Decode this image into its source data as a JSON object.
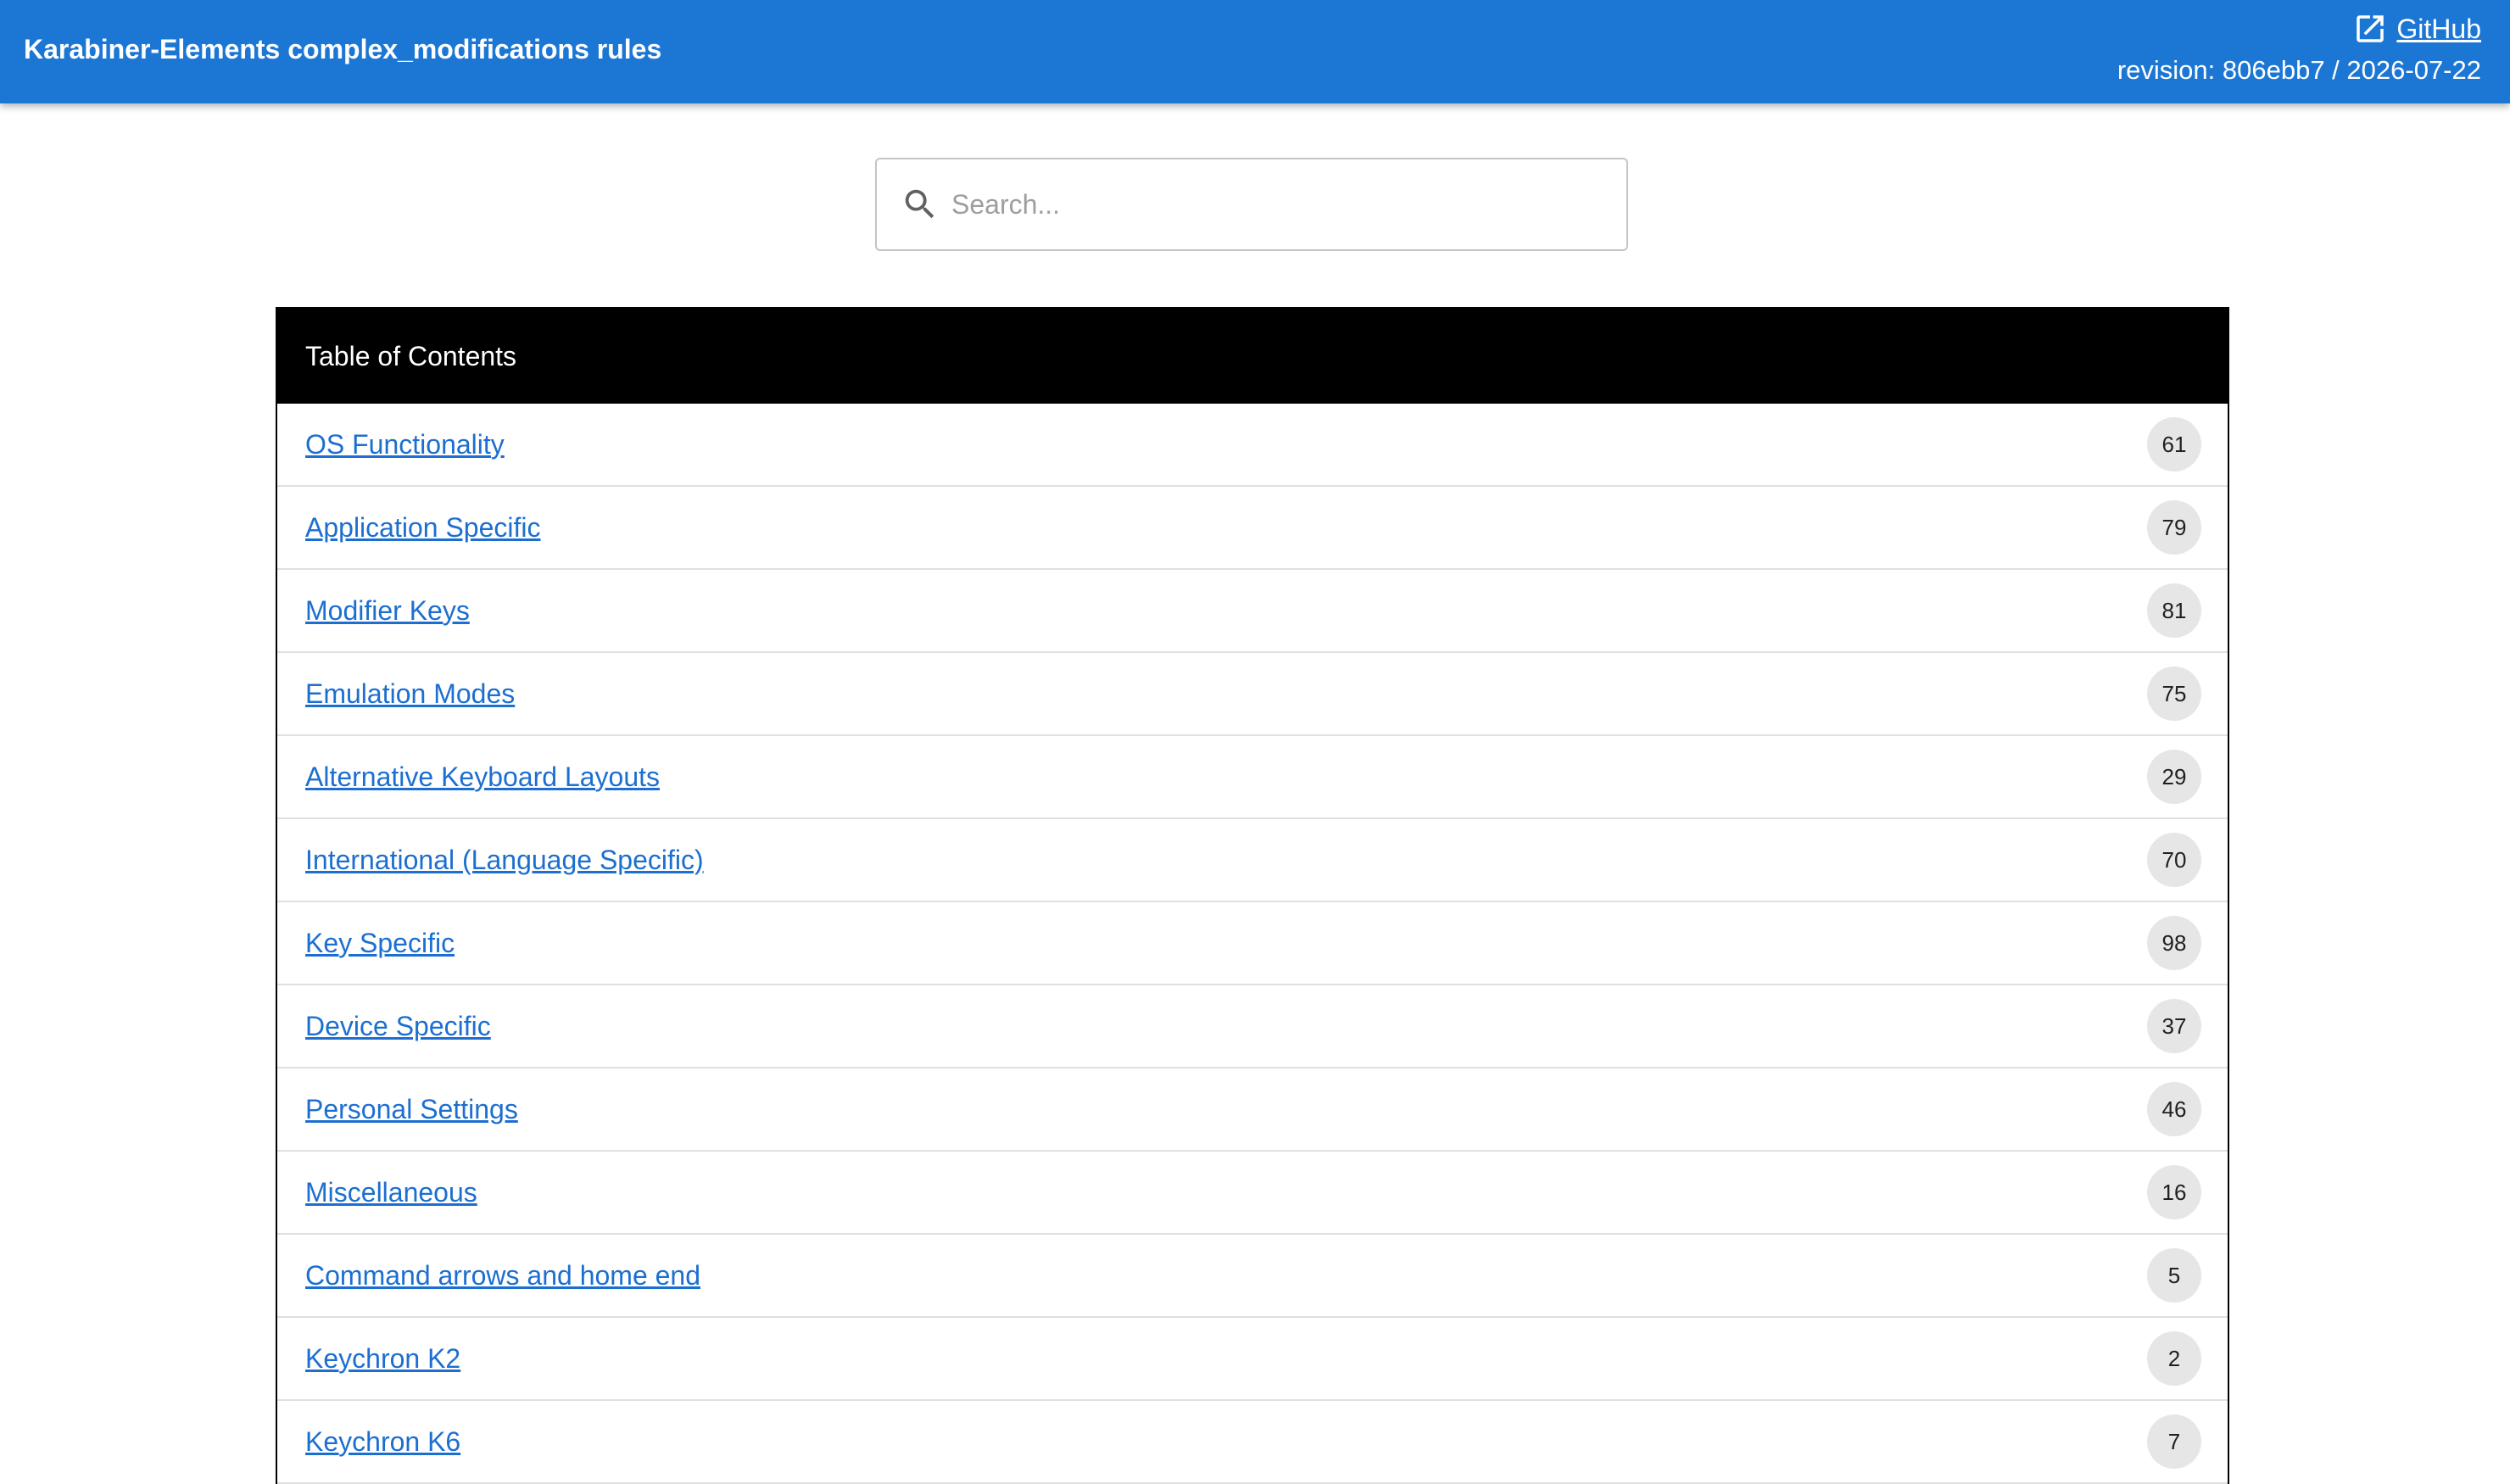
{
  "header": {
    "title": "Karabiner-Elements complex_modifications rules",
    "github_label": "GitHub",
    "revision": "revision: 806ebb7 / 2026-07-22",
    "background_color": "#1c77d4"
  },
  "search": {
    "placeholder": "Search...",
    "value": "",
    "icon": "search-icon"
  },
  "toc": {
    "title": "Table of Contents",
    "items": [
      {
        "label": "OS Functionality",
        "count": "61"
      },
      {
        "label": "Application Specific",
        "count": "79"
      },
      {
        "label": "Modifier Keys",
        "count": "81"
      },
      {
        "label": "Emulation Modes",
        "count": "75"
      },
      {
        "label": "Alternative Keyboard Layouts",
        "count": "29"
      },
      {
        "label": "International (Language Specific)",
        "count": "70"
      },
      {
        "label": "Key Specific",
        "count": "98"
      },
      {
        "label": "Device Specific",
        "count": "37"
      },
      {
        "label": "Personal Settings",
        "count": "46"
      },
      {
        "label": "Miscellaneous",
        "count": "16"
      },
      {
        "label": "Command arrows and home end",
        "count": "5"
      },
      {
        "label": "Keychron K2",
        "count": "2"
      },
      {
        "label": "Keychron K6",
        "count": "7"
      }
    ]
  }
}
